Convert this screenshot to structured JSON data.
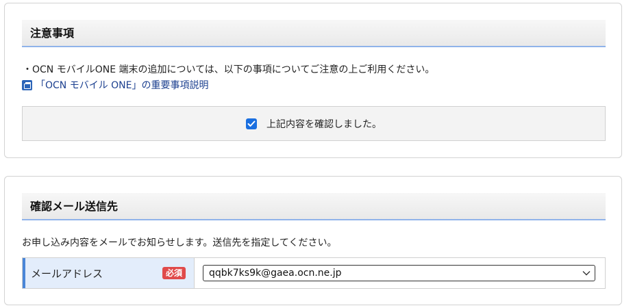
{
  "notice": {
    "heading": "注意事項",
    "text": "・OCN モバイルONE 端末の追加については、以下の事項についてご注意の上ご利用ください。",
    "link_label": "「OCN モバイル ONE」の重要事項説明",
    "link_icon": "new-window-icon",
    "confirm_label": "上記内容を確認しました。",
    "confirm_checked": true
  },
  "mail": {
    "heading": "確認メール送信先",
    "description": "お申し込み内容をメールでお知らせします。送信先を指定してください。",
    "field_label": "メールアドレス",
    "required_badge": "必須",
    "selected_value": "qqbk7ks9k@gaea.ocn.ne.jp",
    "dropdown_icon": "chevron-down-icon"
  },
  "colors": {
    "accent": "#1a6fe0",
    "link": "#1b3f8f",
    "required": "#e04a4a",
    "label_bg": "#e3edfb"
  }
}
